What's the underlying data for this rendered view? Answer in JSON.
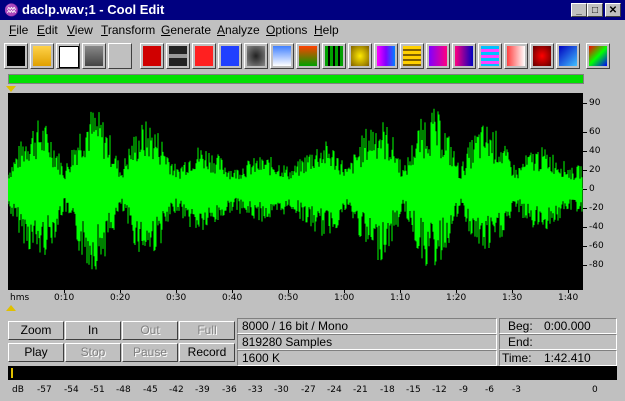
{
  "window": {
    "title": "daclp.wav;1 - Cool Edit",
    "minimize": "_",
    "maximize": "□",
    "close": "✕"
  },
  "menu": [
    {
      "label": "File",
      "accel": "F",
      "rest": "ile"
    },
    {
      "label": "Edit",
      "accel": "E",
      "rest": "dit"
    },
    {
      "label": "View",
      "accel": "V",
      "rest": "iew"
    },
    {
      "label": "Transform",
      "accel": "T",
      "rest": "ransform"
    },
    {
      "label": "Generate",
      "accel": "G",
      "rest": "enerate"
    },
    {
      "label": "Analyze",
      "accel": "A",
      "rest": "nalyze"
    },
    {
      "label": "Options",
      "accel": "O",
      "rest": "ptions"
    },
    {
      "label": "Help",
      "accel": "H",
      "rest": "elp"
    }
  ],
  "toolbar": [
    "edit-view-icon",
    "open-icon",
    "save-icon",
    "record-setup-icon",
    "headphones-icon",
    "rewind-icon",
    "silence-icon",
    "reverse-icon",
    "music-note-icon",
    "noise-icon",
    "envelope-icon",
    "amplify-icon",
    "delay-icon",
    "timer-icon",
    "echo-icon",
    "filter-icon",
    "spectrum-icon",
    "spectrum-view-icon",
    "waves-icon",
    "frequency-analysis-icon",
    "no-noise-icon",
    "sea-wave-icon",
    "color-icon"
  ],
  "waveform": {
    "y_labels": [
      "90",
      "60",
      "40",
      "20",
      "0",
      "-20",
      "-40",
      "-60",
      "-80"
    ],
    "y_values": [
      90,
      60,
      40,
      20,
      0,
      -20,
      -40,
      -60,
      -80
    ],
    "time_labels": [
      "hms",
      "0:10",
      "0:20",
      "0:30",
      "0:40",
      "0:50",
      "1:00",
      "1:10",
      "1:20",
      "1:30",
      "1:40"
    ],
    "wave_color": "#00ff00",
    "background": "#000000"
  },
  "transport": {
    "zoom": "Zoom",
    "in": "In",
    "out": "Out",
    "full": "Full",
    "play": "Play",
    "stop": "Stop",
    "pause": "Pause",
    "record": "Record"
  },
  "info": {
    "format": "8000 / 16 bit / Mono",
    "samples": "819280 Samples",
    "size": "1600 K"
  },
  "selection": {
    "beg_label": "Beg:",
    "beg_value": "0:00.000",
    "end_label": "End:",
    "end_value": "",
    "time_label": "Time:",
    "time_value": "1:42.410"
  },
  "meter": {
    "labels": [
      "dB",
      "-57",
      "-54",
      "-51",
      "-48",
      "-45",
      "-42",
      "-39",
      "-36",
      "-33",
      "-30",
      "-27",
      "-24",
      "-21",
      "-18",
      "-15",
      "-12",
      "-9",
      "-6",
      "-3",
      "0"
    ]
  }
}
